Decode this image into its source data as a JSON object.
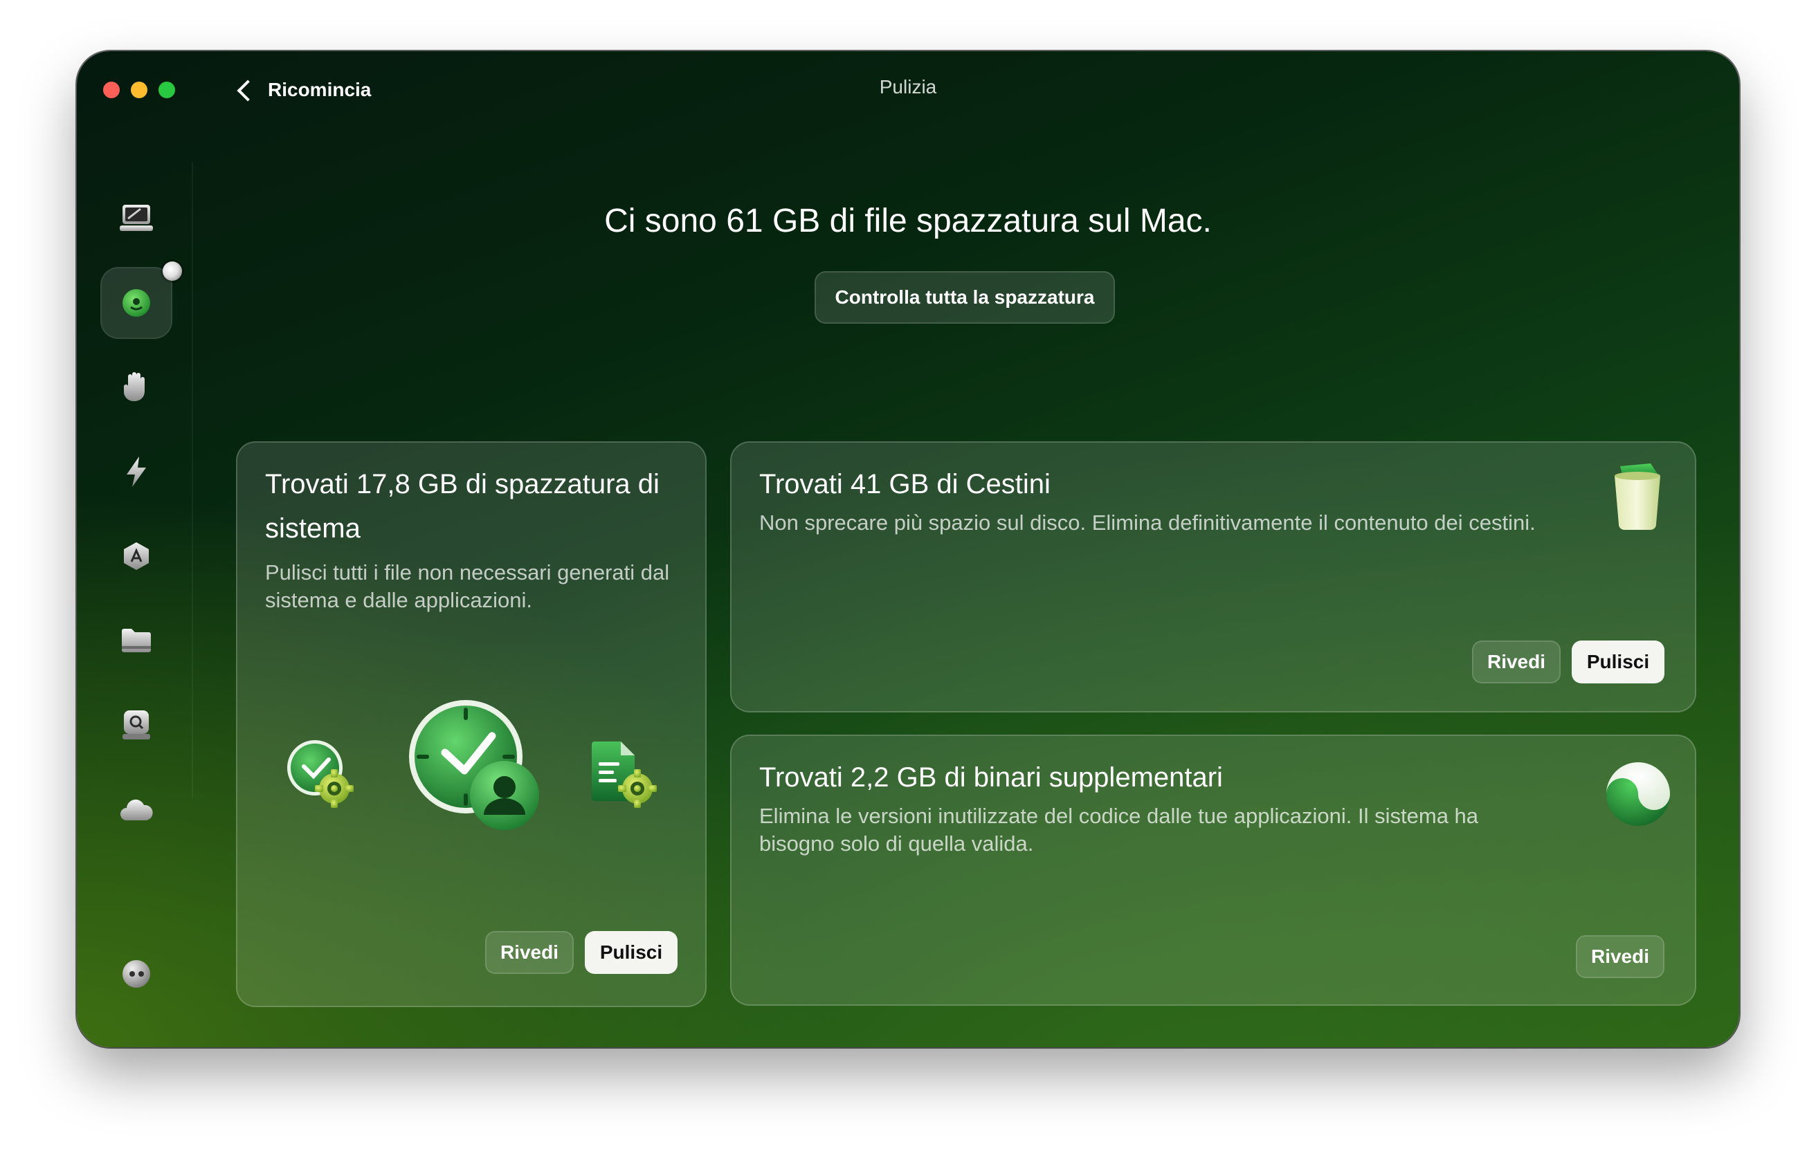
{
  "window": {
    "title": "Pulizia",
    "back_label": "Ricomincia"
  },
  "sidebar": {
    "items": [
      {
        "icon": "display-icon"
      },
      {
        "icon": "cleanup-icon",
        "active": true
      },
      {
        "icon": "hand-icon"
      },
      {
        "icon": "bolt-icon"
      },
      {
        "icon": "app-store-icon"
      },
      {
        "icon": "folder-icon"
      },
      {
        "icon": "disk-search-icon"
      },
      {
        "icon": "cloud-icon"
      }
    ],
    "footer_icon": "assistant-icon"
  },
  "main": {
    "heading": "Ci sono 61 GB di file spazzatura sul Mac.",
    "review_all_label": "Controlla tutta la spazzatura"
  },
  "cards": {
    "system": {
      "title": "Trovati 17,8 GB di spazzatura di sistema",
      "description": "Pulisci tutti i file non necessari generati dal sistema e dalle applicazioni.",
      "review_label": "Rivedi",
      "clean_label": "Pulisci",
      "icons": [
        "clock-gear-icon",
        "clock-user-icon",
        "document-gear-icon"
      ]
    },
    "trash": {
      "title": "Trovati 41 GB di Cestini",
      "description": "Non sprecare più spazio sul disco. Elimina definitivamente il contenuto dei cestini.",
      "review_label": "Rivedi",
      "clean_label": "Pulisci",
      "icon": "trash-bin-icon"
    },
    "binaries": {
      "title": "Trovati 2,2 GB di binari supplementari",
      "description": "Elimina le versioni inutilizzate del codice dalle tue applicazioni. Il sistema ha bisogno solo di quella valida.",
      "review_label": "Rivedi",
      "icon": "binary-icon"
    }
  },
  "colors": {
    "accent_green": "#3bb24a",
    "button_light": "#f4f4f0"
  }
}
